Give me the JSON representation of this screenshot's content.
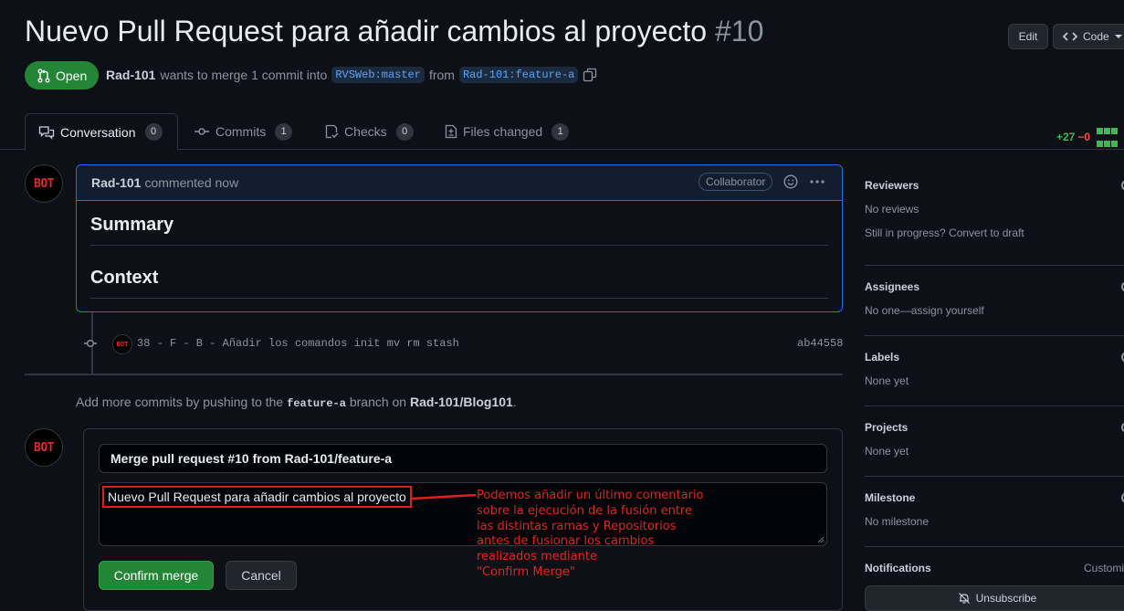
{
  "header": {
    "title": "Nuevo Pull Request para añadir cambios al proyecto",
    "number": "#10",
    "edit_label": "Edit",
    "code_label": "Code"
  },
  "pr": {
    "state": "Open",
    "author": "Rad-101",
    "text_mid": "wants to merge 1 commit into",
    "base_branch": "RVSWeb:master",
    "text_from": "from",
    "head_branch": "Rad-101:feature-a"
  },
  "tabs": [
    {
      "label": "Conversation",
      "count": "0"
    },
    {
      "label": "Commits",
      "count": "1"
    },
    {
      "label": "Checks",
      "count": "0"
    },
    {
      "label": "Files changed",
      "count": "1"
    }
  ],
  "diffstat": {
    "added": "+27",
    "removed": "−0"
  },
  "comment": {
    "author": "Rad-101",
    "meta": "commented now",
    "badge": "Collaborator",
    "heading1": "Summary",
    "heading2": "Context"
  },
  "avatar_text": "BOT",
  "commit": {
    "message": "38 - F - B - Añadir los comandos init mv rm stash",
    "sha": "ab44558"
  },
  "hint": {
    "prefix": "Add more commits by pushing to the",
    "branch": "feature-a",
    "middle": "branch on",
    "repo": "Rad-101/Blog101",
    "suffix": "."
  },
  "merge": {
    "title_value": "Merge pull request #10 from Rad-101/feature-a",
    "body_value": "Nuevo Pull Request para añadir cambios al proyecto",
    "confirm_label": "Confirm merge",
    "cancel_label": "Cancel"
  },
  "annotation": {
    "lines": [
      "Podemos añadir un último comentario",
      "sobre la ejecución de la fusión entre",
      "las distintas ramas y Repositorios",
      "antes de fusionar los cambios",
      "realizados mediante",
      "\"Confirm Merge\""
    ]
  },
  "sidebar": {
    "reviewers_title": "Reviewers",
    "reviewers_value": "No reviews",
    "reviewers_draft": "Still in progress? Convert to draft",
    "assignees_title": "Assignees",
    "assignees_value": "No one—assign yourself",
    "labels_title": "Labels",
    "labels_value": "None yet",
    "projects_title": "Projects",
    "projects_value": "None yet",
    "milestone_title": "Milestone",
    "milestone_value": "No milestone",
    "notifications_title": "Notifications",
    "notifications_custom": "Customi",
    "unsubscribe_label": "Unsubscribe"
  },
  "colors": {
    "background": "#0d1117",
    "accent_green": "#238636",
    "link_blue": "#58a6ff",
    "annotation_red": "#e5231c"
  }
}
